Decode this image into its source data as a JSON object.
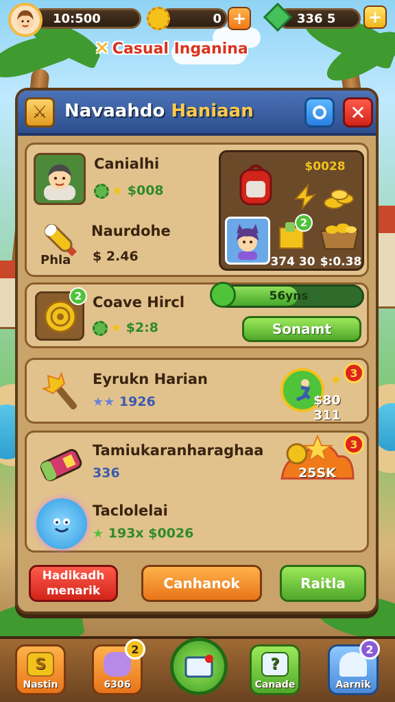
{
  "topbar": {
    "score": "10:500",
    "gold": "0",
    "gems": "336 5",
    "game_title": "Casual Inganina"
  },
  "panel": {
    "title_main": "Navaahdo ",
    "title_accent": "Haniaan"
  },
  "section1": {
    "char_name": "Canialhi",
    "char_value": "$008",
    "tool_name": "Naurdohe",
    "tool_label": "Phla",
    "tool_value": "$ 2.46",
    "shop": {
      "top_right_label": "$0028",
      "cell_value_left": "374 30",
      "cell_value_right": "$:0.38",
      "badge": "2"
    }
  },
  "section2": {
    "name": "Coave Hircl",
    "value": "$2:8",
    "badge": "2",
    "progress_label": "56yns",
    "progress_fraction": 0.56,
    "button_label": "Sonamt"
  },
  "row1": {
    "name": "Eyrukn Harian",
    "value": "1926",
    "reward_value": "$80 311",
    "badge": "3"
  },
  "row2": {
    "name": "Tamiukaranharaghaa",
    "value": "336",
    "reward_value": "25SK",
    "badge": "3"
  },
  "row3": {
    "name": "Taclolelai",
    "value": "193x $0026"
  },
  "buttons": {
    "left": "Hadikadh menarik",
    "center": "Canhanok",
    "right": "Raitla"
  },
  "nav": {
    "item1": "Nastin",
    "item2": "6306",
    "item2_badge": "2",
    "item4": "Canade",
    "item5": "Aarnik",
    "item5_badge": "2"
  },
  "colors": {
    "panel_header": "#2d4e8d",
    "accent_gold": "#ffc94a",
    "button_green": "#4fa82a",
    "button_red": "#d1241a",
    "button_orange": "#e8741a"
  }
}
